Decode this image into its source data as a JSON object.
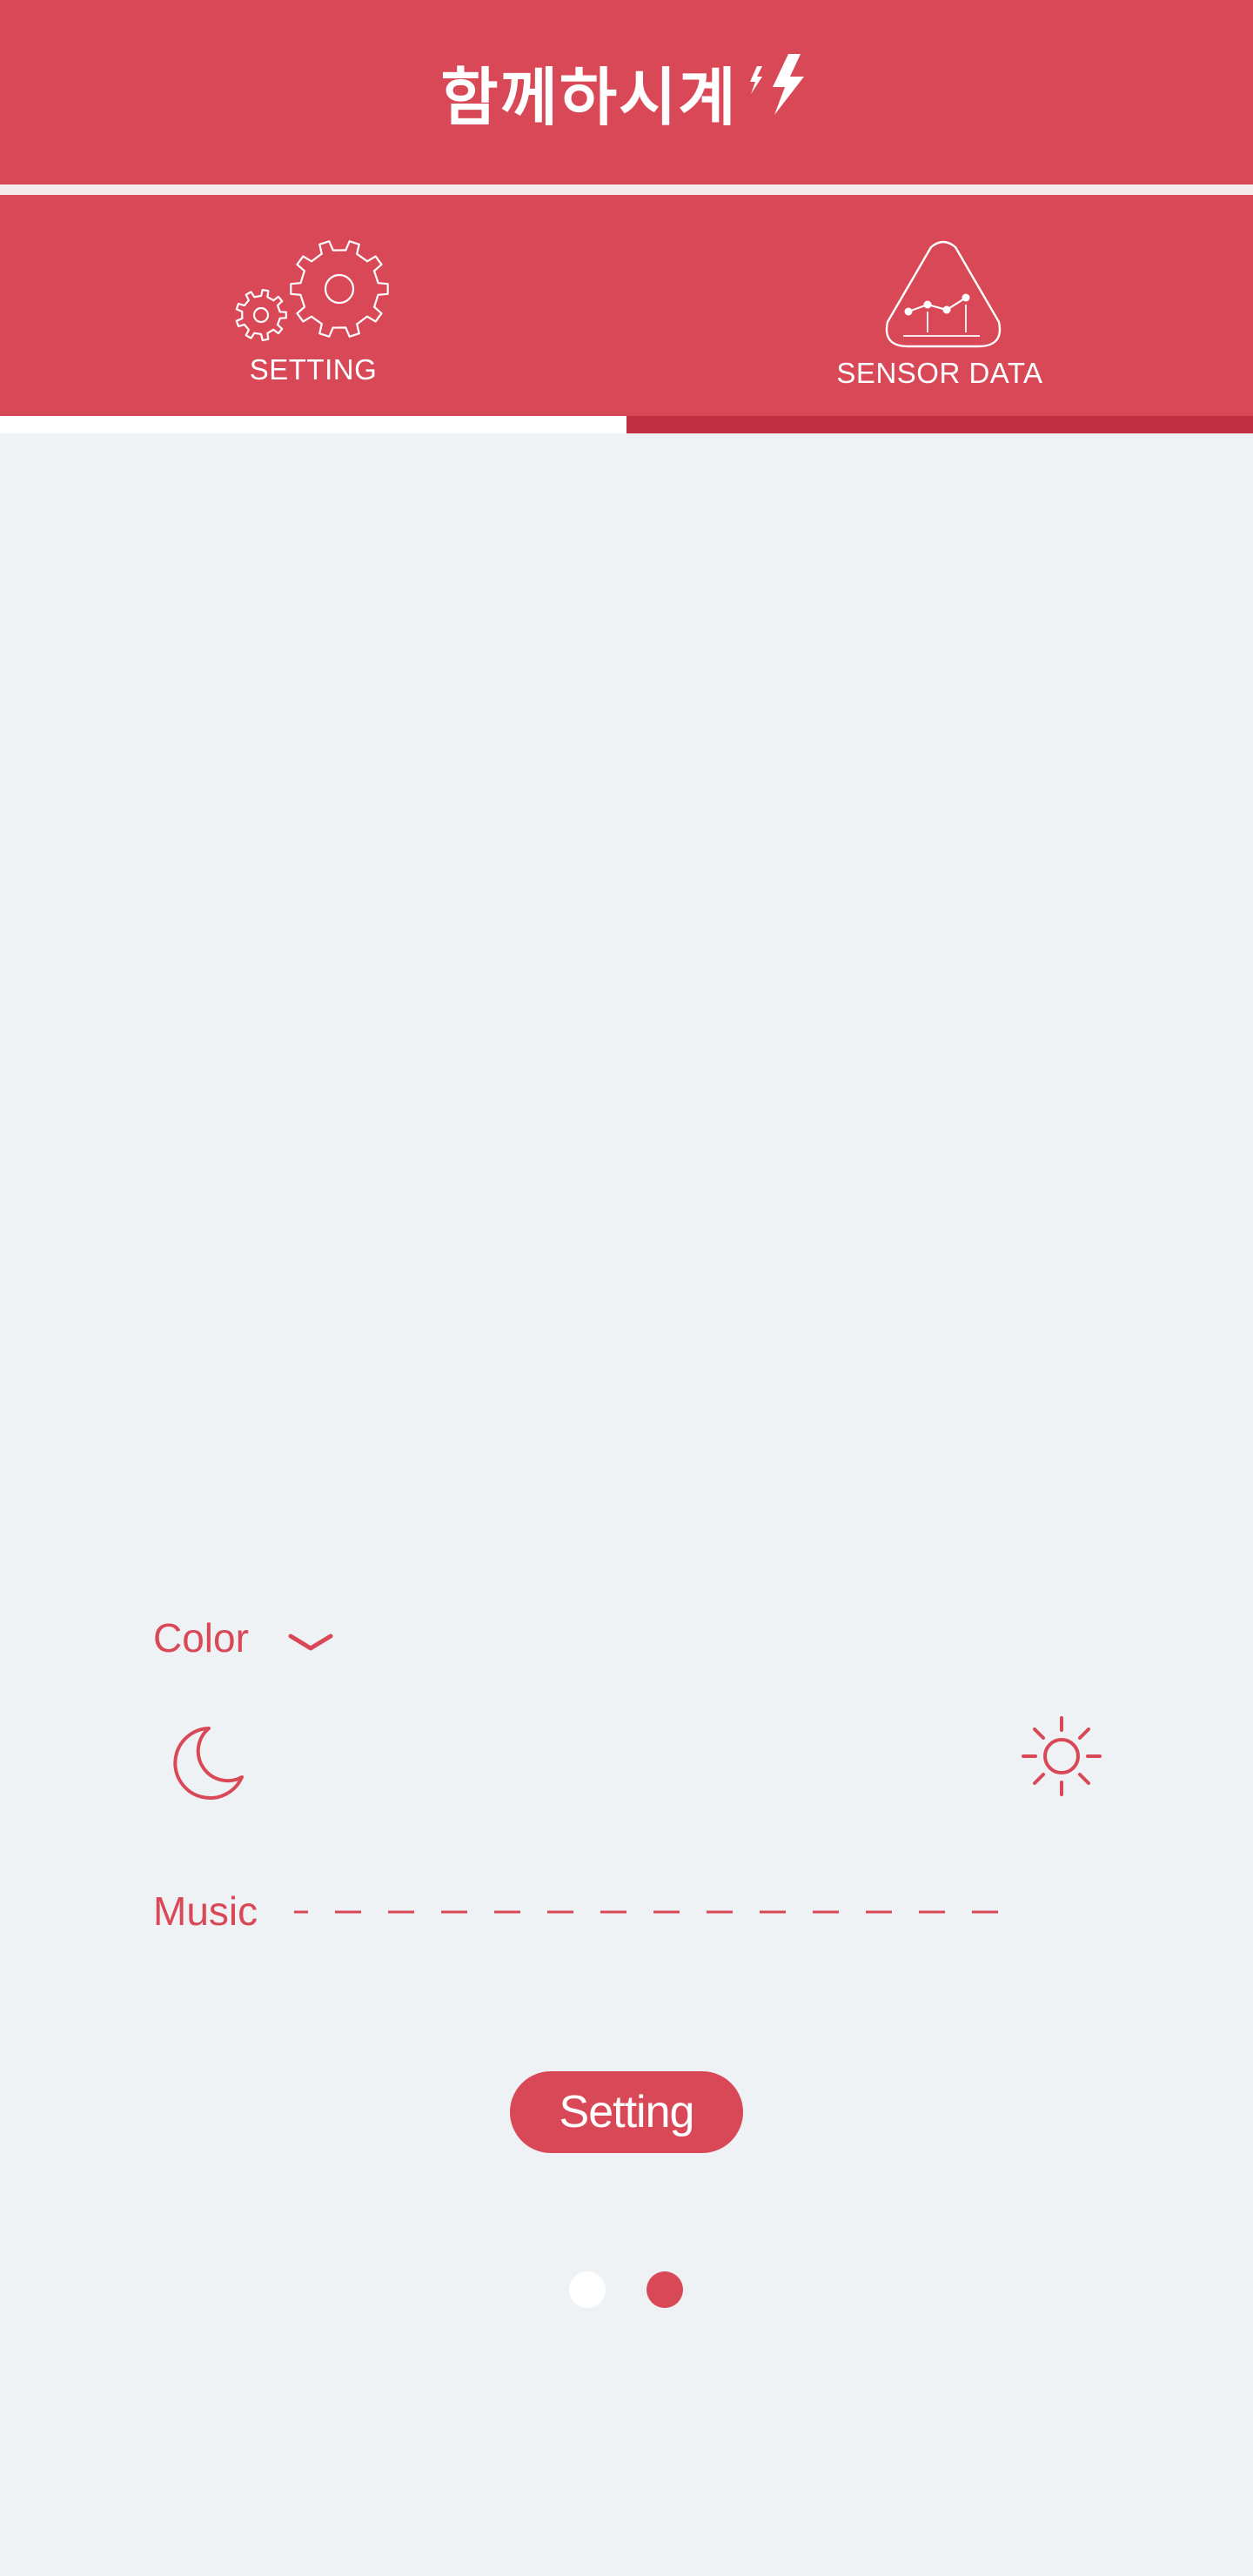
{
  "app": {
    "title": "함께하시계",
    "accent_color": "#d94856",
    "background_color": "#eff2f5"
  },
  "tabs": [
    {
      "label": "SETTING",
      "icon": "gears-icon",
      "active": true
    },
    {
      "label": "SENSOR DATA",
      "icon": "chart-triangle-icon",
      "active": false
    }
  ],
  "settings": {
    "color_label": "Color",
    "color_dropdown_icon": "chevron-down-icon",
    "brightness_min_icon": "moon-icon",
    "brightness_max_icon": "sun-icon",
    "music_label": "Music",
    "button_label": "Setting"
  },
  "pagination": {
    "total": 2,
    "current": 2
  }
}
